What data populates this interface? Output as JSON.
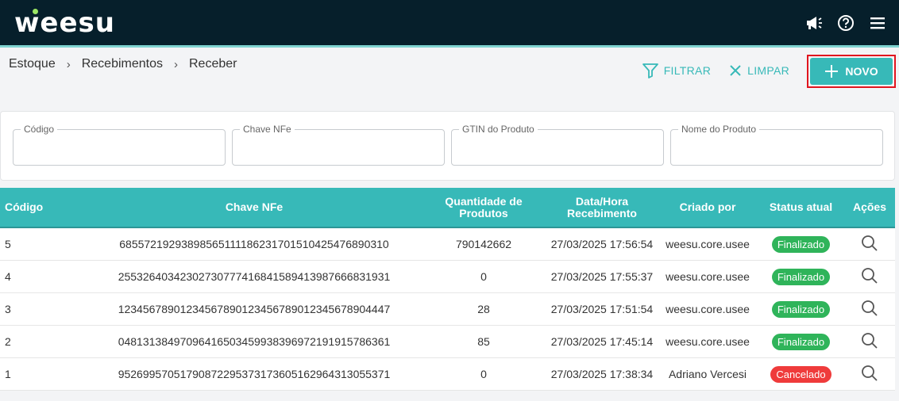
{
  "header": {
    "logo": "weesu",
    "icons": [
      "megaphone-icon",
      "help-icon",
      "menu-icon"
    ]
  },
  "breadcrumb": [
    "Estoque",
    "Recebimentos",
    "Receber"
  ],
  "actions": {
    "filter_label": "FILTRAR",
    "clear_label": "LIMPAR",
    "new_label": "NOVO"
  },
  "filters": {
    "codigo_label": "Código",
    "chave_label": "Chave NFe",
    "gtin_label": "GTIN do Produto",
    "nome_label": "Nome do Produto"
  },
  "table": {
    "headers": {
      "codigo": "Código",
      "chave": "Chave NFe",
      "quantidade": "Quantidade de Produtos",
      "data": "Data/Hora Recebimento",
      "criado": "Criado por",
      "status": "Status atual",
      "acoes": "Ações"
    },
    "rows": [
      {
        "codigo": "5",
        "chave": "68557219293898565111186231701510425476890310",
        "quantidade": "790142662",
        "data": "27/03/2025 17:56:54",
        "criado": "weesu.core.usee",
        "status": "Finalizado"
      },
      {
        "codigo": "4",
        "chave": "25532640342302730777416841589413987666831931",
        "quantidade": "0",
        "data": "27/03/2025 17:55:37",
        "criado": "weesu.core.usee",
        "status": "Finalizado"
      },
      {
        "codigo": "3",
        "chave": "12345678901234567890123456789012345678904447",
        "quantidade": "28",
        "data": "27/03/2025 17:51:54",
        "criado": "weesu.core.usee",
        "status": "Finalizado"
      },
      {
        "codigo": "2",
        "chave": "04813138497096416503459938396972191915786361",
        "quantidade": "85",
        "data": "27/03/2025 17:45:14",
        "criado": "weesu.core.usee",
        "status": "Finalizado"
      },
      {
        "codigo": "1",
        "chave": "95269957051790872295373173605162964313055371",
        "quantidade": "0",
        "data": "27/03/2025 17:38:34",
        "criado": "Adriano Vercesi",
        "status": "Cancelado"
      }
    ]
  },
  "colors": {
    "accent": "#37b9b8",
    "topbar": "#061f2b",
    "status_finalizado": "#2fb45a",
    "status_cancelado": "#ef3b3b"
  }
}
